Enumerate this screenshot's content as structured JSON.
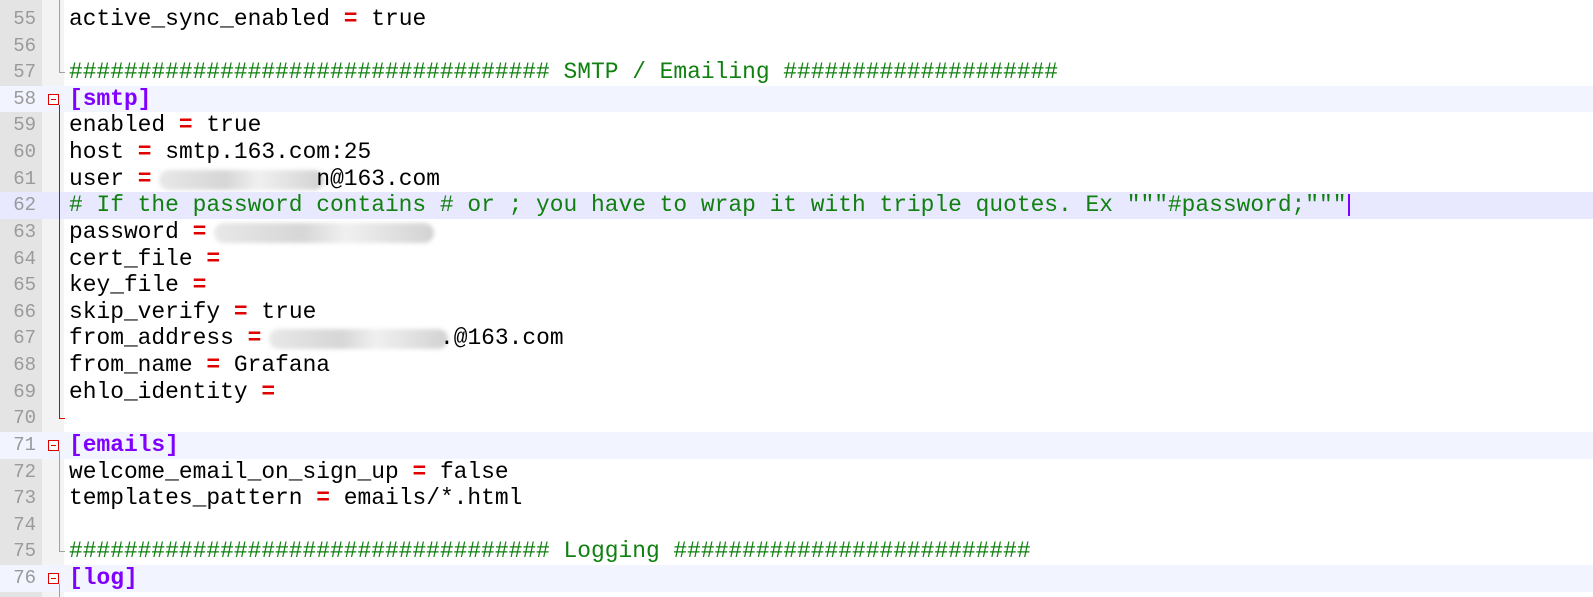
{
  "editor": {
    "lines": [
      {
        "num": "55",
        "kind": "kv",
        "key": "active_sync_enabled",
        "value": "true"
      },
      {
        "num": "56",
        "kind": "blank"
      },
      {
        "num": "57",
        "kind": "comment",
        "text": "################################### SMTP / Emailing ####################"
      },
      {
        "num": "58",
        "kind": "section",
        "text": "[smtp]"
      },
      {
        "num": "59",
        "kind": "kv",
        "key": "enabled",
        "value": "true"
      },
      {
        "num": "60",
        "kind": "kv",
        "key": "host",
        "value": "smtp.163.com:25"
      },
      {
        "num": "61",
        "kind": "kv",
        "key": "user",
        "value": "n@163.com",
        "redacted": true
      },
      {
        "num": "62",
        "kind": "comment",
        "text": "# If the password contains # or ; you have to wrap it with triple quotes. Ex \"\"\"#password;\"\"\"",
        "caret": true
      },
      {
        "num": "63",
        "kind": "kv",
        "key": "password",
        "value": "",
        "redacted": true
      },
      {
        "num": "64",
        "kind": "kv",
        "key": "cert_file",
        "value": ""
      },
      {
        "num": "65",
        "kind": "kv",
        "key": "key_file",
        "value": ""
      },
      {
        "num": "66",
        "kind": "kv",
        "key": "skip_verify",
        "value": "true"
      },
      {
        "num": "67",
        "kind": "kv",
        "key": "from_address",
        "value": ".@163.com",
        "redacted": true
      },
      {
        "num": "68",
        "kind": "kv",
        "key": "from_name",
        "value": "Grafana"
      },
      {
        "num": "69",
        "kind": "kv",
        "key": "ehlo_identity",
        "value": ""
      },
      {
        "num": "70",
        "kind": "blank"
      },
      {
        "num": "71",
        "kind": "section",
        "text": "[emails]"
      },
      {
        "num": "72",
        "kind": "kv",
        "key": "welcome_email_on_sign_up",
        "value": "false"
      },
      {
        "num": "73",
        "kind": "kv",
        "key": "templates_pattern",
        "value": "emails/*.html"
      },
      {
        "num": "74",
        "kind": "blank"
      },
      {
        "num": "75",
        "kind": "comment",
        "text": "################################### Logging ##########################"
      },
      {
        "num": "76",
        "kind": "section",
        "text": "[log]"
      }
    ],
    "operator": "=",
    "colors": {
      "operator": "#e00000",
      "comment": "#108010",
      "section": "#8000ff",
      "caret_line": "#e8e8ff",
      "fold_marker": "#e00000"
    }
  }
}
